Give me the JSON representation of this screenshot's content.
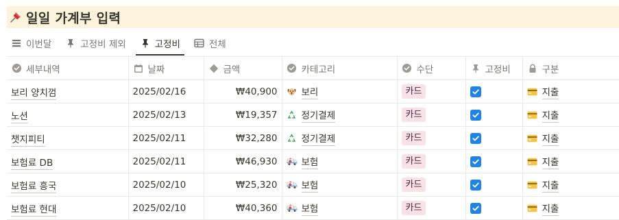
{
  "page": {
    "title": "일일 가계부 입력",
    "title_icon": "pushpin-icon"
  },
  "tabs": [
    {
      "label": "이번달",
      "icon": "list-icon",
      "active": false
    },
    {
      "label": "고정비 제외",
      "icon": "pin-icon",
      "active": false
    },
    {
      "label": "고정비",
      "icon": "pin-icon",
      "active": true
    },
    {
      "label": "전체",
      "icon": "table-icon",
      "active": false
    }
  ],
  "columns": [
    {
      "label": "세부내역",
      "icon": "check-circle-icon"
    },
    {
      "label": "날짜",
      "icon": "calendar-icon"
    },
    {
      "label": "금액",
      "icon": "diamond-icon"
    },
    {
      "label": "카테고리",
      "icon": "check-circle-icon"
    },
    {
      "label": "수단",
      "icon": "check-circle-icon"
    },
    {
      "label": "고정비",
      "icon": "pin-icon"
    },
    {
      "label": "구분",
      "icon": "lock-icon"
    }
  ],
  "rows": [
    {
      "desc": "보리 양치껌",
      "date": "2025/02/16",
      "amount": "₩40,900",
      "category": "보리",
      "category_icon": "dog-emoji",
      "method": "카드",
      "fixed": true,
      "kind": "지출"
    },
    {
      "desc": "노션",
      "date": "2025/02/13",
      "amount": "₩19,357",
      "category": "정기결제",
      "category_icon": "recycle-emoji",
      "method": "카드",
      "fixed": true,
      "kind": "지출"
    },
    {
      "desc": "챗지피티",
      "date": "2025/02/11",
      "amount": "₩32,280",
      "category": "정기결제",
      "category_icon": "recycle-emoji",
      "method": "카드",
      "fixed": true,
      "kind": "지출"
    },
    {
      "desc": "보험료 DB",
      "date": "2025/02/11",
      "amount": "₩46,930",
      "category": "보험",
      "category_icon": "ambulance-emoji",
      "method": "카드",
      "fixed": true,
      "kind": "지출"
    },
    {
      "desc": "보험료 흥국",
      "date": "2025/02/10",
      "amount": "₩25,320",
      "category": "보험",
      "category_icon": "ambulance-emoji",
      "method": "카드",
      "fixed": true,
      "kind": "지출"
    },
    {
      "desc": "보험료 현대",
      "date": "2025/02/10",
      "amount": "₩40,360",
      "category": "보험",
      "category_icon": "ambulance-emoji",
      "method": "카드",
      "fixed": true,
      "kind": "지출"
    }
  ],
  "colors": {
    "title_bg": "#fbf3db",
    "pill_bg": "#f9e1e8",
    "checkbox": "#2383e2"
  }
}
